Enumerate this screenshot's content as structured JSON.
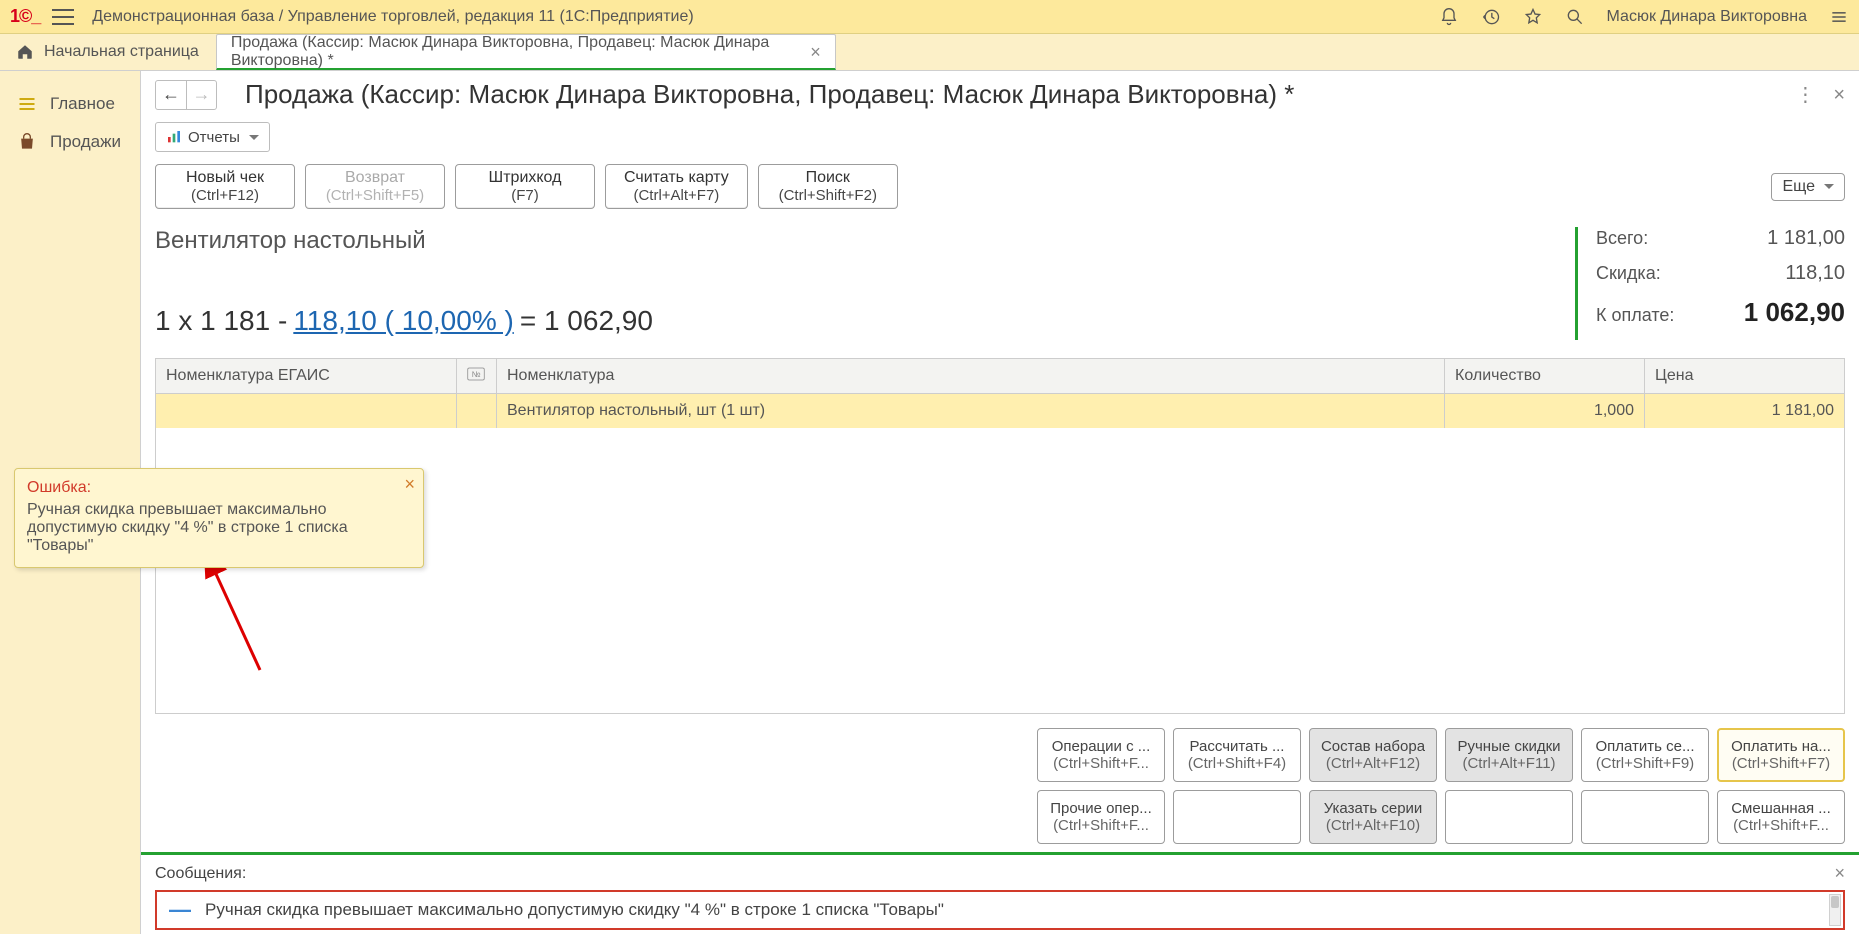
{
  "app": {
    "title": "Демонстрационная база / Управление торговлей, редакция 11   (1С:Предприятие)",
    "user": "Масюк Динара Викторовна"
  },
  "tabs": {
    "home": "Начальная страница",
    "active": "Продажа (Кассир: Масюк Динара Викторовна, Продавец: Масюк Динара Викторовна) *"
  },
  "sidebar": {
    "items": [
      {
        "label": "Главное"
      },
      {
        "label": "Продажи"
      }
    ]
  },
  "page": {
    "title": "Продажа (Кассир: Масюк Динара Викторовна, Продавец: Масюк Динара Викторовна) *",
    "reports_btn": "Отчеты",
    "more_btn": "Еще",
    "buttons_row": [
      {
        "l1": "Новый чек",
        "l2": "(Ctrl+F12)",
        "disabled": false
      },
      {
        "l1": "Возврат",
        "l2": "(Ctrl+Shift+F5)",
        "disabled": true
      },
      {
        "l1": "Штрихкод",
        "l2": "(F7)",
        "disabled": false
      },
      {
        "l1": "Считать карту",
        "l2": "(Ctrl+Alt+F7)",
        "disabled": false
      },
      {
        "l1": "Поиск",
        "l2": "(Ctrl+Shift+F2)",
        "disabled": false
      }
    ],
    "product_name": "Вентилятор настольный",
    "calc": {
      "prefix": "1 х 1 181 - ",
      "discount_text": "118,10 ( 10,00% )",
      "suffix": " = 1 062,90"
    },
    "totals": {
      "label_total": "Всего:",
      "value_total": "1 181,00",
      "label_discount": "Скидка:",
      "value_discount": "118,10",
      "label_topay": "К оплате:",
      "value_topay": "1 062,90"
    },
    "table": {
      "headers": {
        "egais": "Номенклатура ЕГАИС",
        "num": "№",
        "nom": "Номенклатура",
        "qty": "Количество",
        "price": "Цена"
      },
      "rows": [
        {
          "egais": "",
          "num": "",
          "nom": "Вентилятор настольный, шт (1 шт)",
          "qty": "1,000",
          "price": "1 181,00"
        }
      ]
    },
    "actions": [
      [
        {
          "l1": "Операции с ...",
          "l2": "(Ctrl+Shift+F...",
          "style": "plain"
        },
        {
          "l1": "Рассчитать ...",
          "l2": "(Ctrl+Shift+F4)",
          "style": "plain"
        },
        {
          "l1": "Состав набора",
          "l2": "(Ctrl+Alt+F12)",
          "style": "grey"
        },
        {
          "l1": "Ручные скидки",
          "l2": "(Ctrl+Alt+F11)",
          "style": "grey"
        },
        {
          "l1": "Оплатить се...",
          "l2": "(Ctrl+Shift+F9)",
          "style": "plain"
        },
        {
          "l1": "Оплатить на...",
          "l2": "(Ctrl+Shift+F7)",
          "style": "highlight"
        }
      ],
      [
        {
          "l1": "Прочие опер...",
          "l2": "(Ctrl+Shift+F...",
          "style": "plain"
        },
        {
          "l1": "",
          "l2": "",
          "style": "empty"
        },
        {
          "l1": "Указать серии",
          "l2": "(Ctrl+Alt+F10)",
          "style": "grey"
        },
        {
          "l1": "",
          "l2": "",
          "style": "empty"
        },
        {
          "l1": "",
          "l2": "",
          "style": "empty"
        },
        {
          "l1": "Смешанная ...",
          "l2": "(Ctrl+Shift+F...",
          "style": "plain"
        }
      ]
    ]
  },
  "tooltip": {
    "title": "Ошибка:",
    "text": "Ручная скидка превышает максимально допустимую скидку \"4 %\" в строке 1 списка \"Товары\""
  },
  "messages": {
    "title": "Сообщения:",
    "text": "Ручная скидка превышает максимально допустимую скидку \"4 %\" в строке 1 списка \"Товары\""
  }
}
